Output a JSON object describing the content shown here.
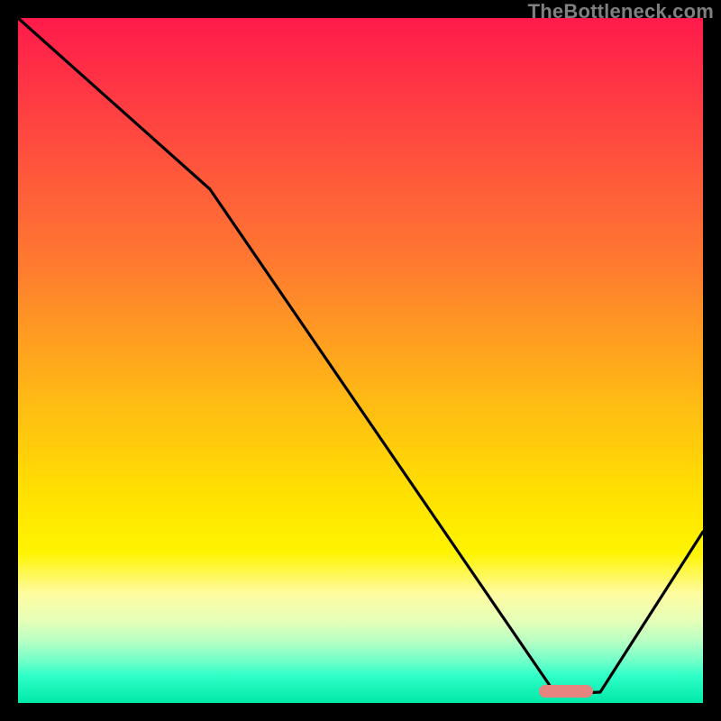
{
  "watermark": "TheBottleneck.com",
  "chart_data": {
    "type": "line",
    "title": "",
    "xlabel": "",
    "ylabel": "",
    "xlim": [
      0,
      100
    ],
    "ylim": [
      0,
      100
    ],
    "series": [
      {
        "name": "bottleneck-curve",
        "x": [
          0,
          28,
          78,
          85,
          100
        ],
        "values": [
          100,
          75,
          2,
          1.5,
          25
        ]
      }
    ],
    "annotations": [
      {
        "name": "valley-marker",
        "x_range": [
          76,
          84
        ],
        "y": 1.8
      }
    ],
    "background_gradient": {
      "orientation": "vertical",
      "stops": [
        {
          "pos": 0.0,
          "color": "#ff1a4b"
        },
        {
          "pos": 0.18,
          "color": "#ff4b3f"
        },
        {
          "pos": 0.36,
          "color": "#ff7a30"
        },
        {
          "pos": 0.55,
          "color": "#ffb815"
        },
        {
          "pos": 0.7,
          "color": "#ffe200"
        },
        {
          "pos": 0.84,
          "color": "#fffca0"
        },
        {
          "pos": 0.91,
          "color": "#b7ffc3"
        },
        {
          "pos": 1.0,
          "color": "#00e8a8"
        }
      ]
    }
  }
}
